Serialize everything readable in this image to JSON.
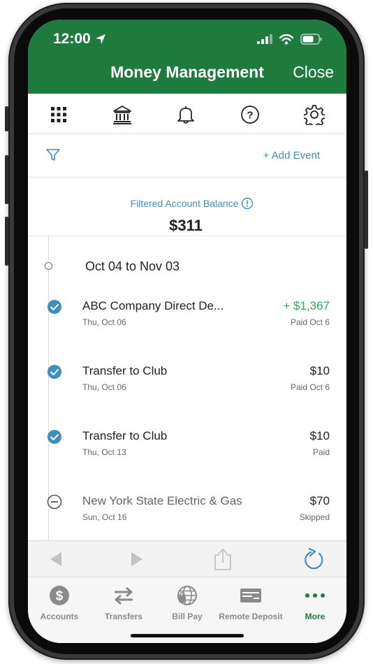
{
  "status": {
    "time": "12:00"
  },
  "header": {
    "title": "Money Management",
    "close_label": "Close"
  },
  "toolbar": {
    "icons": [
      "grid-icon",
      "bank-icon",
      "bell-icon",
      "help-icon",
      "gear-icon"
    ],
    "add_event_label": "+ Add Event"
  },
  "balance": {
    "label": "Filtered Account Balance",
    "value": "$311"
  },
  "timeline": {
    "range_label": "Oct 04 to Nov 03",
    "events": [
      {
        "title": "ABC Company Direct De...",
        "date": "Thu, Oct 06",
        "amount": "+ $1,367",
        "status": "Paid Oct 6",
        "state": "completed",
        "kind": "credit"
      },
      {
        "title": "Transfer to Club",
        "date": "Thu, Oct 06",
        "amount": "$10",
        "status": "Paid Oct 6",
        "state": "completed",
        "kind": "debit"
      },
      {
        "title": "Transfer to Club",
        "date": "Thu, Oct 13",
        "amount": "$10",
        "status": "Paid",
        "state": "completed",
        "kind": "debit"
      },
      {
        "title": "New York State Electric & Gas",
        "date": "Sun, Oct 16",
        "amount": "$70",
        "status": "Skipped",
        "state": "skipped",
        "kind": "debit"
      }
    ]
  },
  "tabs": {
    "accounts": "Accounts",
    "transfers": "Transfers",
    "bill_pay": "Bill Pay",
    "remote_deposit": "Remote Deposit",
    "more": "More"
  },
  "colors": {
    "brand_green": "#1f7a3e",
    "accent_blue": "#3d8fbf",
    "credit_green": "#2fa65a"
  }
}
